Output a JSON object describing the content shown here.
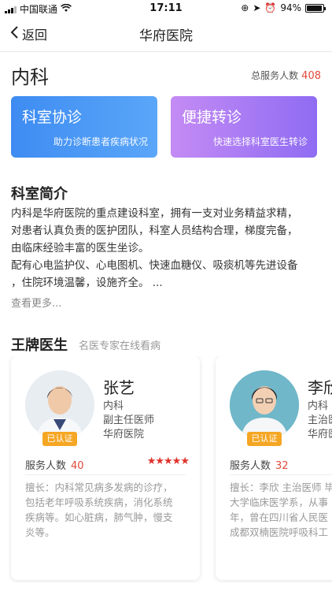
{
  "status_bar": {
    "carrier": "中国联通",
    "time": "17:11",
    "battery": "94%",
    "battery_level": 0.94
  },
  "nav": {
    "back_label": "返回",
    "title": "华府医院"
  },
  "department": {
    "name": "内科",
    "service_label": "总服务人数",
    "service_count": "408"
  },
  "actions": [
    {
      "title": "科室协诊",
      "subtitle": "助力诊断患者疾病状况",
      "color_start": "#3e8cf2",
      "color_end": "#5aa6f9"
    },
    {
      "title": "便捷转诊",
      "subtitle": "快速选择科室医生转诊",
      "color_start": "#c48bf4",
      "color_end": "#8f6cf3"
    }
  ],
  "intro": {
    "title": "科室简介",
    "lines": [
      "内科是华府医院的重点建设科室，拥有一支对业务精益求精，",
      "对患者认真负责的医护团队，科室人员结构合理，梯度完备，",
      "由临床经验丰富的医生坐诊。",
      "配有心电监护仪、心电图机、快速血糖仪、吸痰机等先进设备",
      "，住院环境温馨，设施齐全。 ..."
    ],
    "more_label": "查看更多..."
  },
  "doctors_section": {
    "title": "王牌医生",
    "subtitle": "名医专家在线看病"
  },
  "doctors": [
    {
      "name": "张艺",
      "department": "内科",
      "position": "副主任医师",
      "hospital": "华府医院",
      "badge": "已认证",
      "service_label": "服务人数",
      "service_count": "40",
      "rating": 5,
      "stars": "★★★★★",
      "skill_lines": [
        "擅长：内科常见病多发病的诊疗，",
        "包括老年呼吸系统疾病，消化系统",
        "疾病等。如心脏病，肺气肿，慢支",
        "炎等。"
      ]
    },
    {
      "name": "李欣",
      "department": "内科",
      "position": "主治医",
      "hospital": "华府医",
      "badge": "已认证",
      "service_label": "服务人数",
      "service_count": "32",
      "skill_lines": [
        "擅长：李欣 主治医师 毕",
        "大学临床医学系，从事",
        "年，曾在四川省人民医",
        "成都双楠医院呼吸科工"
      ]
    }
  ],
  "colors": {
    "accent_red": "#e24a3b",
    "badge_orange": "#f5a623",
    "star_red": "#e0332b"
  }
}
